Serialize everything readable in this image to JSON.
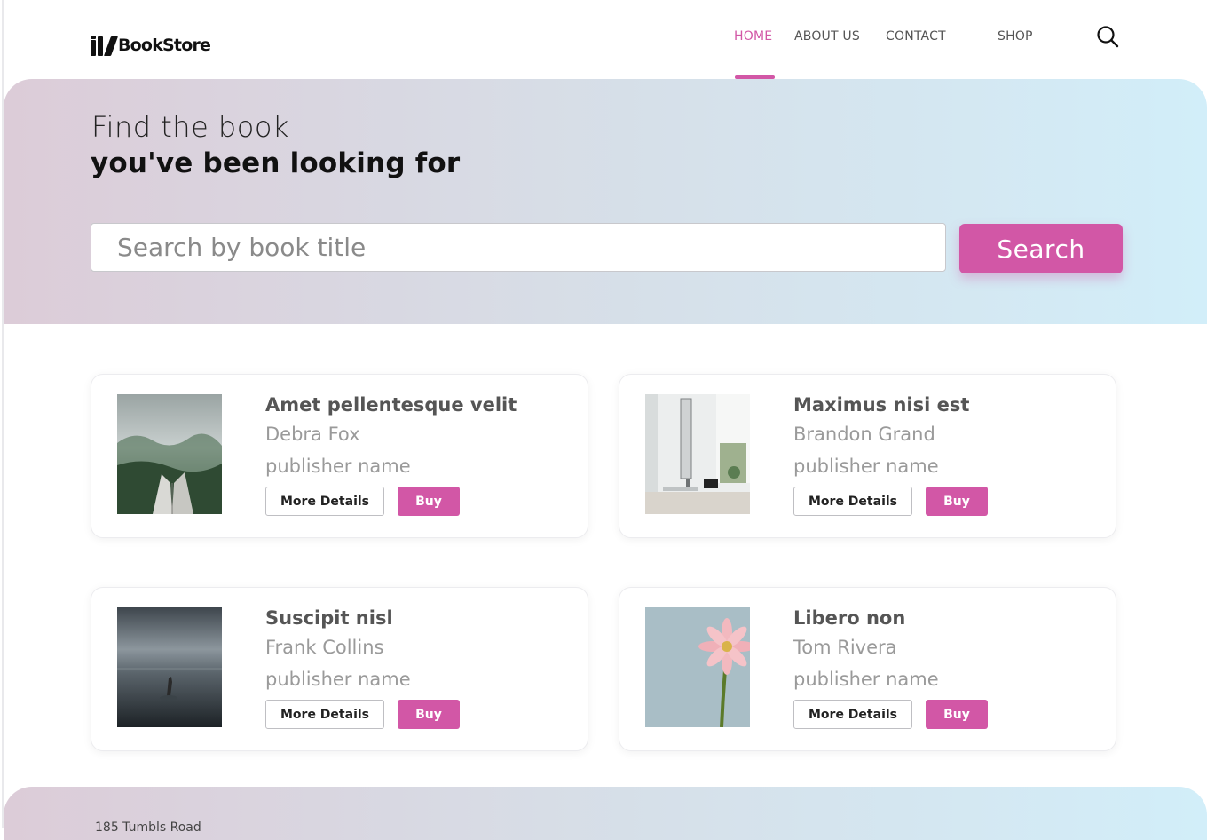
{
  "brand": {
    "name": "BookStore"
  },
  "nav": {
    "items": [
      {
        "label": "HOME",
        "active": true
      },
      {
        "label": "ABOUT US",
        "active": false
      },
      {
        "label": "CONTACT",
        "active": false
      },
      {
        "label": "SHOP",
        "active": false
      }
    ],
    "search_icon": "search-icon"
  },
  "hero": {
    "line1": "Find the book",
    "line2": "you've been looking for",
    "search_placeholder": "Search by book title",
    "search_button": "Search"
  },
  "books": [
    {
      "title": "Amet pellentesque velit",
      "author": "Debra Fox",
      "publisher": "publisher name",
      "details_label": "More Details",
      "buy_label": "Buy",
      "cover": "open-book-forest-image"
    },
    {
      "title": "Maximus nisi est",
      "author": "Brandon Grand",
      "publisher": "publisher name",
      "details_label": "More Details",
      "buy_label": "Buy",
      "cover": "desk-computer-image"
    },
    {
      "title": "Suscipit nisl",
      "author": "Frank Collins",
      "publisher": "publisher name",
      "details_label": "More Details",
      "buy_label": "Buy",
      "cover": "hand-in-sea-image"
    },
    {
      "title": "Libero non",
      "author": "Tom Rivera",
      "publisher": "publisher name",
      "details_label": "More Details",
      "buy_label": "Buy",
      "cover": "pink-flower-image"
    }
  ],
  "footer": {
    "text": "185 Tumbls Road"
  },
  "colors": {
    "accent": "#d257a6",
    "hero_gradient_start": "#dcccd8",
    "hero_gradient_end": "#d2eef9"
  }
}
